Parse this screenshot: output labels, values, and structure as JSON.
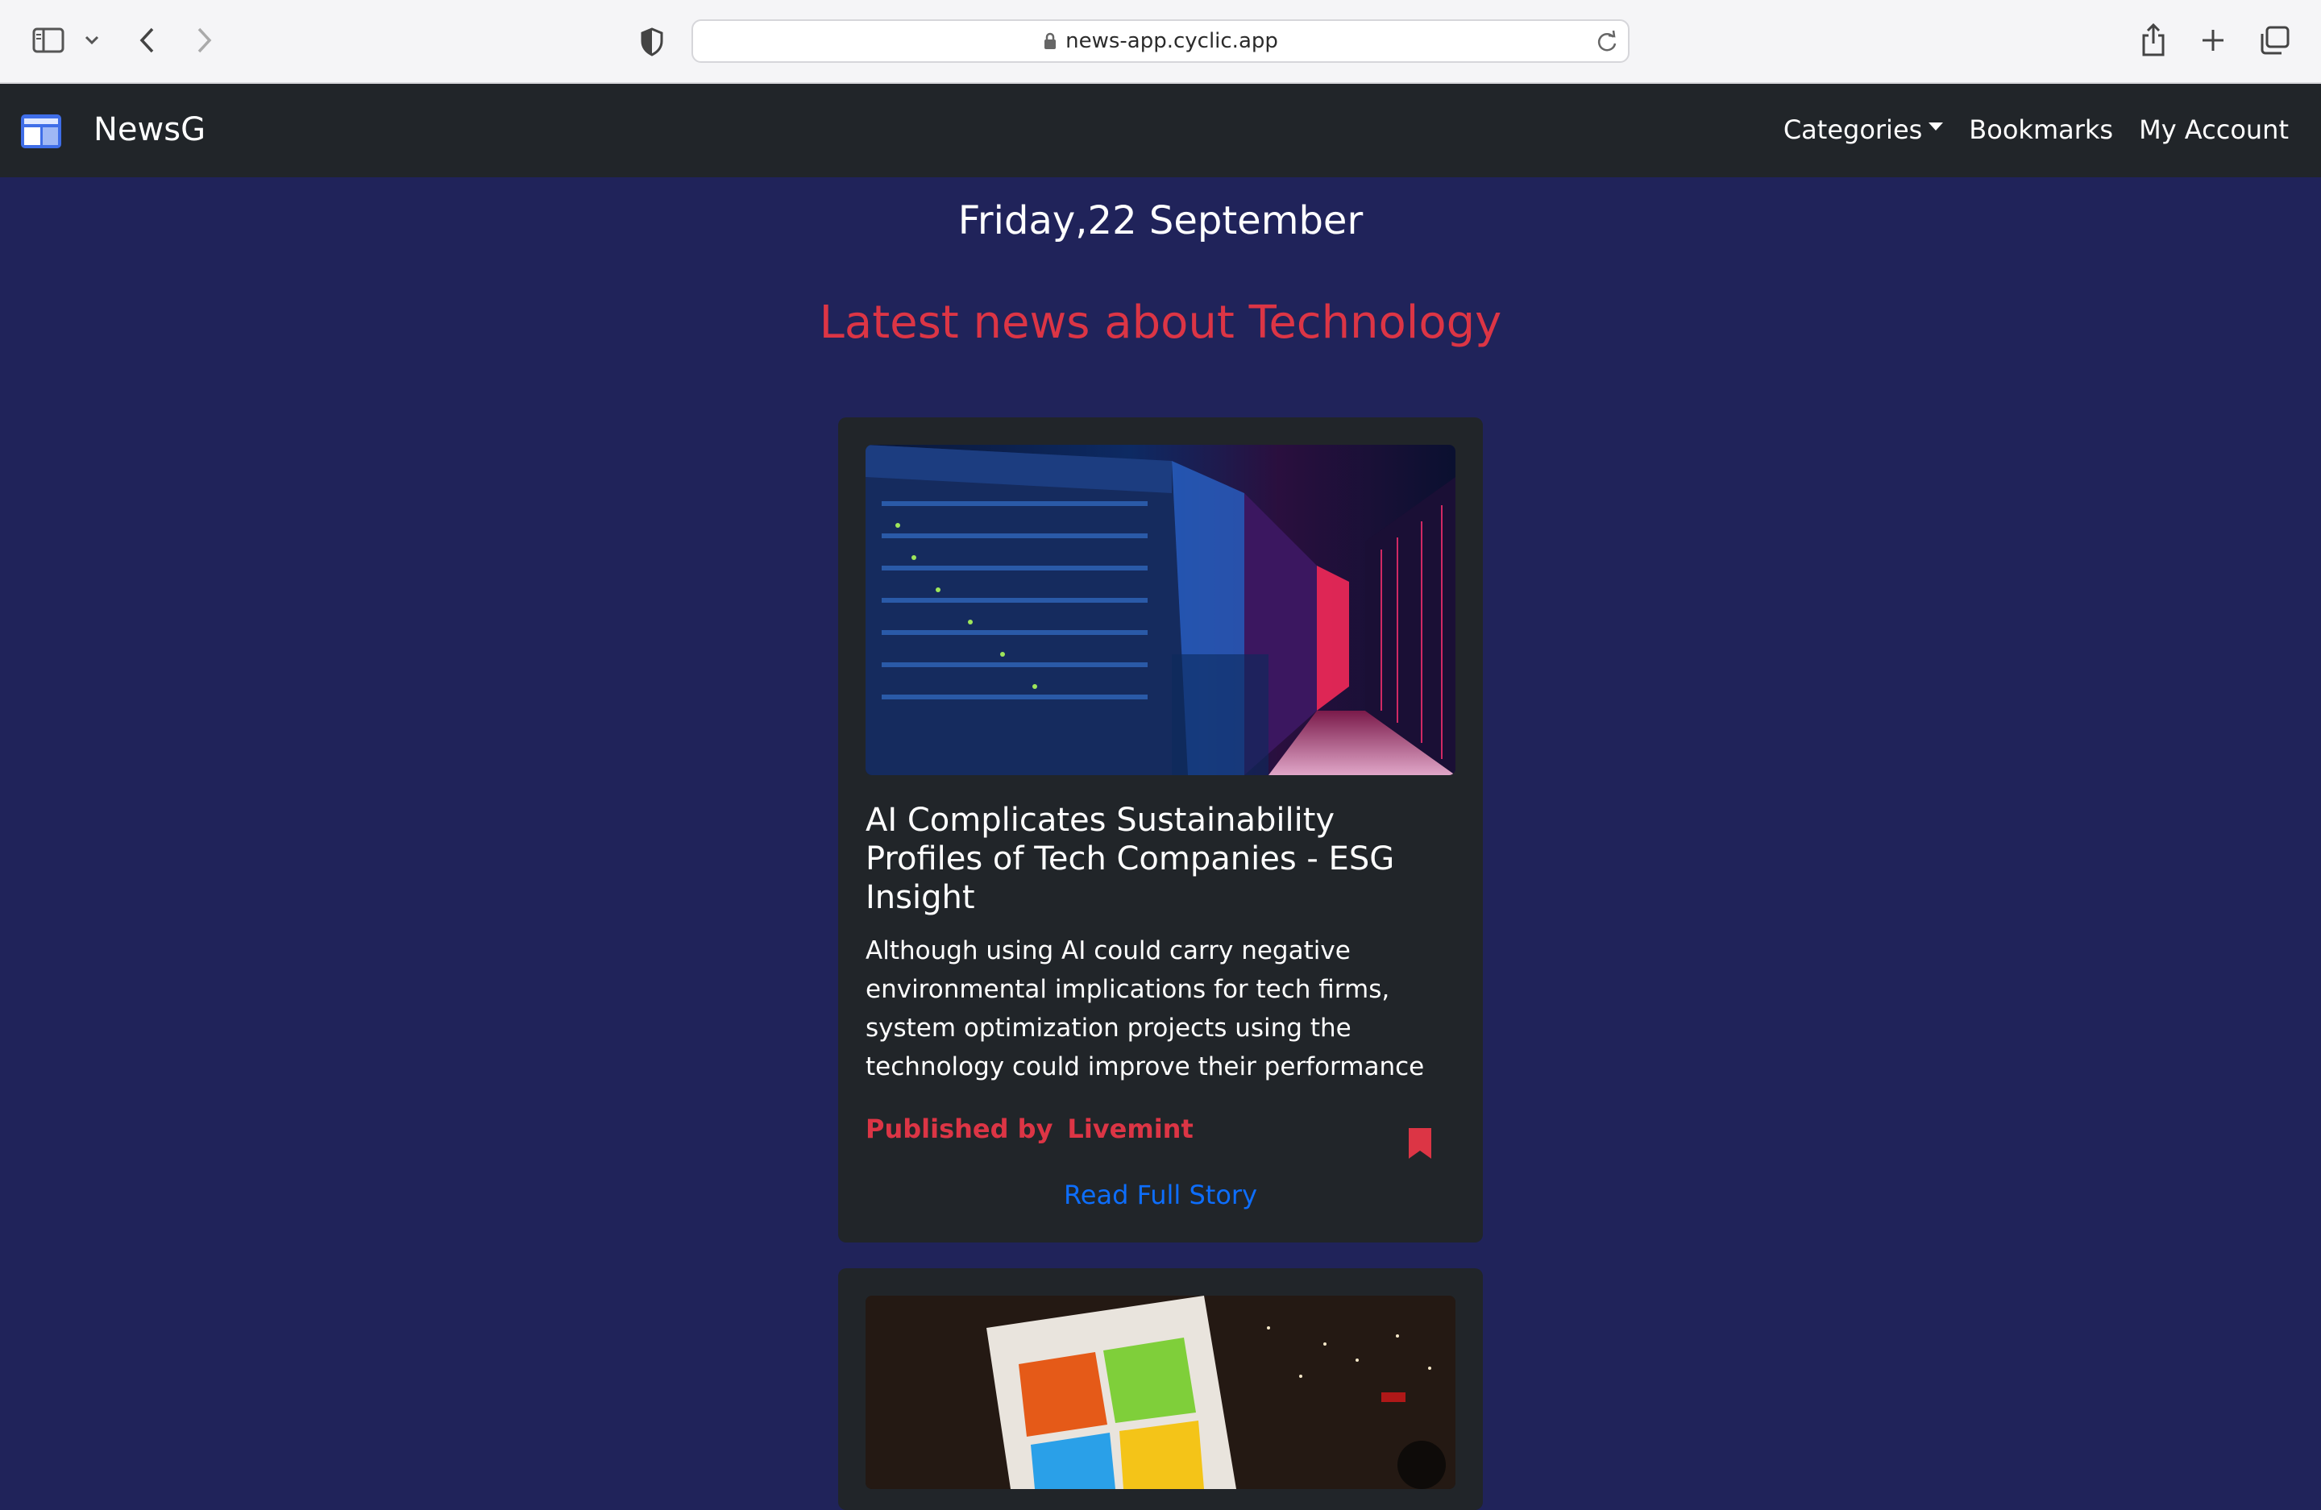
{
  "browser": {
    "url": "news-app.cyclic.app"
  },
  "site": {
    "brand": "NewsG",
    "nav": {
      "categories": "Categories",
      "bookmarks": "Bookmarks",
      "account": "My Account"
    }
  },
  "page": {
    "date": "Friday,22 September",
    "heading": "Latest news about Technology"
  },
  "articles": [
    {
      "title": "AI Complicates Sustainability Profiles of Tech Companies - ESG Insight",
      "description": "Although using AI could carry negative environmental implications for tech firms, system optimization projects using the technology could improve their performance",
      "published_label": "Published by",
      "publisher": "Livemint",
      "read_more": "Read Full Story"
    }
  ],
  "colors": {
    "page_bg": "#20235a",
    "navbar_bg": "#212529",
    "card_bg": "#212529",
    "accent_red": "#dc3545",
    "link_blue": "#0d6efd"
  }
}
